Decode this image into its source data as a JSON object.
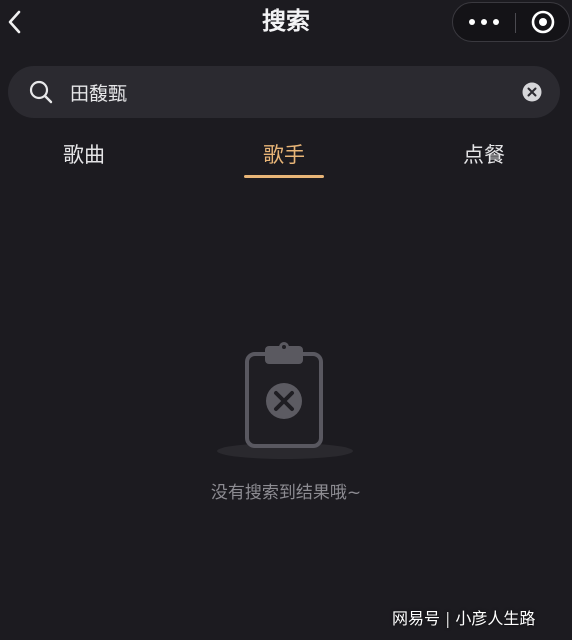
{
  "header": {
    "title": "搜索",
    "back_icon": "chevron-left-icon",
    "more_icon": "more-dots-icon",
    "close_icon": "target-circle-icon"
  },
  "search": {
    "value": "田馥甄",
    "icon": "search-icon",
    "clear_icon": "clear-circle-icon"
  },
  "tabs": [
    {
      "label": "歌曲",
      "active": false
    },
    {
      "label": "歌手",
      "active": true
    },
    {
      "label": "点餐",
      "active": false
    }
  ],
  "empty_state": {
    "icon": "clipboard-x-icon",
    "message": "没有搜索到结果哦~"
  },
  "watermark": {
    "brand": "网易号",
    "author": "小彦人生路"
  },
  "colors": {
    "background": "#1c1b20",
    "accent": "#e8b577",
    "search_bg": "#2b2a30"
  }
}
